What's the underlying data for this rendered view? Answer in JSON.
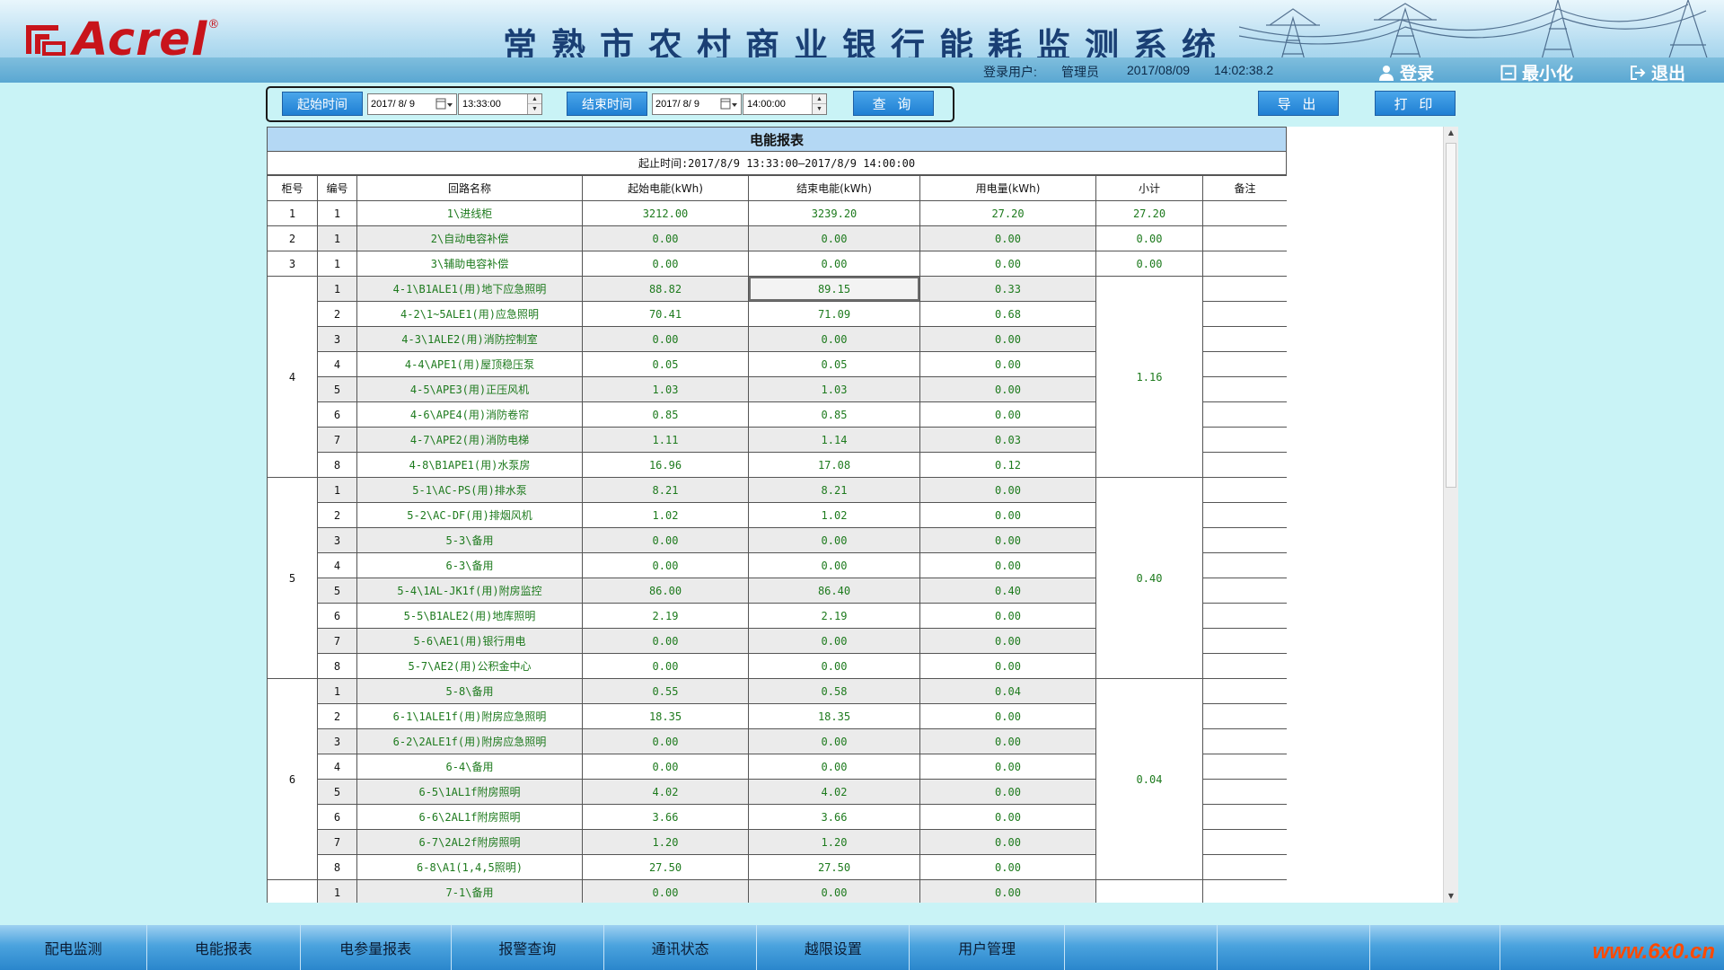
{
  "header": {
    "logo_text": "Acrel",
    "logo_reg": "®",
    "title": "常熟市农村商业银行能耗监测系统",
    "user_label": "登录用户:",
    "user_name": "管理员",
    "date": "2017/08/09",
    "time": "14:02:38.2",
    "login_label": "登录",
    "minimize_label": "最小化",
    "exit_label": "退出"
  },
  "query": {
    "start_label": "起始时间",
    "start_date": "2017/ 8/ 9",
    "start_time": "13:33:00",
    "end_label": "结束时间",
    "end_date": "2017/ 8/ 9",
    "end_time": "14:00:00",
    "search_label": "查 询",
    "export_label": "导 出",
    "print_label": "打 印"
  },
  "report": {
    "title": "电能报表",
    "range": "起止时间:2017/8/9 13:33:00—2017/8/9 14:00:00",
    "columns": [
      "柜号",
      "编号",
      "回路名称",
      "起始电能(kWh)",
      "结束电能(kWh)",
      "用电量(kWh)",
      "小计",
      "备注"
    ],
    "groups": [
      {
        "cabinet": "1",
        "subtotal": "27.20",
        "rows": [
          {
            "no": "1",
            "name": "1\\进线柜",
            "start": "3212.00",
            "end": "3239.20",
            "usage": "27.20"
          }
        ]
      },
      {
        "cabinet": "2",
        "subtotal": "0.00",
        "rows": [
          {
            "no": "1",
            "name": "2\\自动电容补偿",
            "start": "0.00",
            "end": "0.00",
            "usage": "0.00"
          }
        ]
      },
      {
        "cabinet": "3",
        "subtotal": "0.00",
        "rows": [
          {
            "no": "1",
            "name": "3\\辅助电容补偿",
            "start": "0.00",
            "end": "0.00",
            "usage": "0.00"
          }
        ]
      },
      {
        "cabinet": "4",
        "subtotal": "1.16",
        "rows": [
          {
            "no": "1",
            "name": "4-1\\B1ALE1(用)地下应急照明",
            "start": "88.82",
            "end": "89.15",
            "usage": "0.33"
          },
          {
            "no": "2",
            "name": "4-2\\1~5ALE1(用)应急照明",
            "start": "70.41",
            "end": "71.09",
            "usage": "0.68"
          },
          {
            "no": "3",
            "name": "4-3\\1ALE2(用)消防控制室",
            "start": "0.00",
            "end": "0.00",
            "usage": "0.00"
          },
          {
            "no": "4",
            "name": "4-4\\APE1(用)屋顶稳压泵",
            "start": "0.05",
            "end": "0.05",
            "usage": "0.00"
          },
          {
            "no": "5",
            "name": "4-5\\APE3(用)正压风机",
            "start": "1.03",
            "end": "1.03",
            "usage": "0.00"
          },
          {
            "no": "6",
            "name": "4-6\\APE4(用)消防卷帘",
            "start": "0.85",
            "end": "0.85",
            "usage": "0.00"
          },
          {
            "no": "7",
            "name": "4-7\\APE2(用)消防电梯",
            "start": "1.11",
            "end": "1.14",
            "usage": "0.03"
          },
          {
            "no": "8",
            "name": "4-8\\B1APE1(用)水泵房",
            "start": "16.96",
            "end": "17.08",
            "usage": "0.12"
          }
        ]
      },
      {
        "cabinet": "5",
        "subtotal": "0.40",
        "rows": [
          {
            "no": "1",
            "name": "5-1\\AC-PS(用)排水泵",
            "start": "8.21",
            "end": "8.21",
            "usage": "0.00"
          },
          {
            "no": "2",
            "name": "5-2\\AC-DF(用)排烟风机",
            "start": "1.02",
            "end": "1.02",
            "usage": "0.00"
          },
          {
            "no": "3",
            "name": "5-3\\备用",
            "start": "0.00",
            "end": "0.00",
            "usage": "0.00"
          },
          {
            "no": "4",
            "name": "6-3\\备用",
            "start": "0.00",
            "end": "0.00",
            "usage": "0.00"
          },
          {
            "no": "5",
            "name": "5-4\\1AL-JK1f(用)附房监控",
            "start": "86.00",
            "end": "86.40",
            "usage": "0.40"
          },
          {
            "no": "6",
            "name": "5-5\\B1ALE2(用)地库照明",
            "start": "2.19",
            "end": "2.19",
            "usage": "0.00"
          },
          {
            "no": "7",
            "name": "5-6\\AE1(用)银行用电",
            "start": "0.00",
            "end": "0.00",
            "usage": "0.00"
          },
          {
            "no": "8",
            "name": "5-7\\AE2(用)公积金中心",
            "start": "0.00",
            "end": "0.00",
            "usage": "0.00"
          }
        ]
      },
      {
        "cabinet": "6",
        "subtotal": "0.04",
        "rows": [
          {
            "no": "1",
            "name": "5-8\\备用",
            "start": "0.55",
            "end": "0.58",
            "usage": "0.04"
          },
          {
            "no": "2",
            "name": "6-1\\1ALE1f(用)附房应急照明",
            "start": "18.35",
            "end": "18.35",
            "usage": "0.00"
          },
          {
            "no": "3",
            "name": "6-2\\2ALE1f(用)附房应急照明",
            "start": "0.00",
            "end": "0.00",
            "usage": "0.00"
          },
          {
            "no": "4",
            "name": "6-4\\备用",
            "start": "0.00",
            "end": "0.00",
            "usage": "0.00"
          },
          {
            "no": "5",
            "name": "6-5\\1AL1f附房照明",
            "start": "4.02",
            "end": "4.02",
            "usage": "0.00"
          },
          {
            "no": "6",
            "name": "6-6\\2AL1f附房照明",
            "start": "3.66",
            "end": "3.66",
            "usage": "0.00"
          },
          {
            "no": "7",
            "name": "6-7\\2AL2f附房照明",
            "start": "1.20",
            "end": "1.20",
            "usage": "0.00"
          },
          {
            "no": "8",
            "name": "6-8\\A1(1,4,5照明)",
            "start": "27.50",
            "end": "27.50",
            "usage": "0.00"
          }
        ]
      },
      {
        "cabinet": "",
        "subtotal": "",
        "rows": [
          {
            "no": "1",
            "name": "7-1\\备用",
            "start": "0.00",
            "end": "0.00",
            "usage": "0.00"
          }
        ]
      }
    ]
  },
  "nav": {
    "items": [
      "配电监测",
      "电能报表",
      "电参量报表",
      "报警查询",
      "通讯状态",
      "越限设置",
      "用户管理",
      "",
      "",
      "",
      ""
    ]
  },
  "watermark": "www.6x0.cn",
  "colors": {
    "background": "#c9f3f6",
    "value_text": "#1d7a1d",
    "title_bar": "#b4d8f4",
    "logo_red": "#c8141b",
    "button_blue": "#1f7fd3"
  }
}
